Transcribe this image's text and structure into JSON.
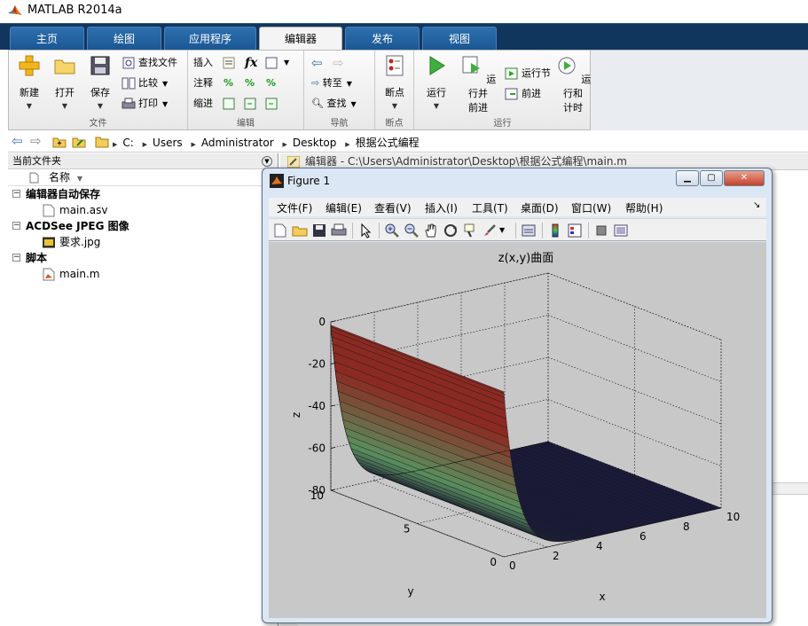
{
  "app": {
    "title": "MATLAB R2014a"
  },
  "tabs": [
    "主页",
    "绘图",
    "应用程序",
    "编辑器",
    "发布",
    "视图"
  ],
  "ribbon": {
    "file": {
      "new": "新建",
      "open": "打开",
      "save": "保存",
      "find_files": "查找文件",
      "compare": "比较",
      "print": "打印",
      "label": "文件"
    },
    "edit": {
      "insert": "插入",
      "comment": "注释",
      "indent": "缩进",
      "fx": "fx",
      "label": "编辑"
    },
    "navigate": {
      "goto": "转至",
      "find": "查找",
      "label": "导航"
    },
    "breakpoints": {
      "btn": "断点",
      "label": "断点"
    },
    "run": {
      "run": "运行",
      "run_advance": "运行并",
      "run_advance2": "前进",
      "run_section": "运行节",
      "advance": "前进",
      "run_time": "运行和",
      "run_time2": "计时",
      "label": "运行"
    }
  },
  "path": [
    "C:",
    "Users",
    "Administrator",
    "Desktop",
    "根据公式编程"
  ],
  "left_panel": {
    "title": "当前文件夹",
    "col_name": "名称",
    "groups": [
      {
        "label": "编辑器自动保存",
        "items": [
          "main.asv"
        ]
      },
      {
        "label": "ACDSee JPEG 图像",
        "items": [
          "要求.jpg"
        ]
      },
      {
        "label": "脚本",
        "items": [
          "main.m"
        ]
      }
    ]
  },
  "editor": {
    "title": "编辑器 - C:\\Users\\Administrator\\Desktop\\根据公式编程\\main.m"
  },
  "figure": {
    "title": "Figure 1",
    "menu": [
      "文件(F)",
      "编辑(E)",
      "查看(V)",
      "插入(I)",
      "工具(T)",
      "桌面(D)",
      "窗口(W)",
      "帮助(H)"
    ],
    "min_label": "▁",
    "max_label": "▢",
    "close_label": "✕",
    "pin_label": "↘"
  },
  "chart_data": {
    "type": "surface",
    "title": "z(x,y)曲面",
    "xlabel": "x",
    "ylabel": "y",
    "zlabel": "z",
    "xlim": [
      0,
      10
    ],
    "ylim": [
      0,
      10
    ],
    "zlim": [
      -80,
      0
    ],
    "xticks": [
      0,
      2,
      4,
      6,
      8,
      10
    ],
    "yticks": [
      0,
      5,
      10
    ],
    "zticks": [
      0,
      -20,
      -40,
      -60,
      -80
    ],
    "grid": true,
    "colors": {
      "surface_high": "#8b2a22",
      "surface_mid": "#5a8f5e",
      "surface_low": "#1a1a3a"
    }
  }
}
